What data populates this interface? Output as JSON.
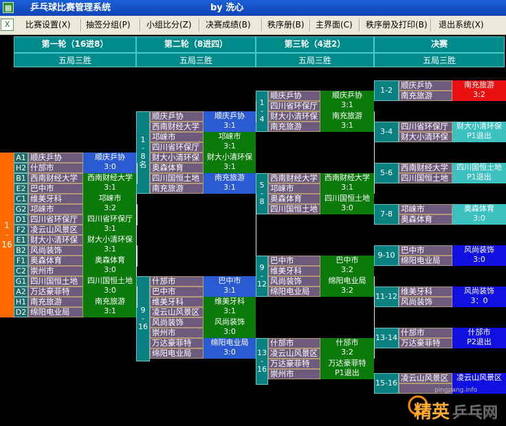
{
  "window": {
    "title": "乒乓球比赛管理系统",
    "author": "by 洗心"
  },
  "menu": [
    "比赛设置(X)",
    "抽签分组(P)",
    "小组比分(Z)",
    "决赛成绩(B)",
    "秩序册(B)",
    "主界面(C)",
    "秩序册及打印(B)",
    "退出系统(X)"
  ],
  "rounds": [
    {
      "title": "第一轮（16进8）",
      "format": "五局三胜"
    },
    {
      "title": "第二轮（8进四）",
      "format": "五局三胜"
    },
    {
      "title": "第三轮（4进2）",
      "format": "五局三胜"
    },
    {
      "title": "决赛",
      "format": "五局三胜"
    }
  ],
  "labels": {
    "big": "1\n-\n16",
    "r2a": "1\n-\n8\n名",
    "r2b": "9\n-\n16",
    "r3a": "1\n-\n4",
    "r3b": "5\n-\n8",
    "r3c": "9\n-\n12",
    "r3d": "13\n-\n16"
  },
  "round1": [
    {
      "s1": "A1",
      "t1": "顺庆乒协",
      "s2": "H2",
      "t2": "什邡市",
      "winner": "顺庆乒协",
      "score": "3:0",
      "color": "#2b5bd3"
    },
    {
      "s1": "B1",
      "t1": "西南财经大学",
      "s2": "E2",
      "t2": "巴中市",
      "winner": "西南财经大学",
      "score": "3:1",
      "color": "#0b7a0b"
    },
    {
      "s1": "C1",
      "t1": "维美牙科",
      "s2": "G2",
      "t2": "邛崃市",
      "winner": "邛崃市",
      "score": "3:2",
      "color": "#0b7a0b"
    },
    {
      "s1": "D1",
      "t1": "四川省环保厅",
      "s2": "F2",
      "t2": "凌云山风景区",
      "winner": "四川省环保厅",
      "score": "3:1",
      "color": "#0b7a0b"
    },
    {
      "s1": "E1",
      "t1": "财大小清环保",
      "s2": "B2",
      "t2": "风尚装饰",
      "winner": "财大小清环保",
      "score": "3:1",
      "color": "#0b7a0b"
    },
    {
      "s1": "F1",
      "t1": "奥森体育",
      "s2": "C2",
      "t2": "崇州市",
      "winner": "奥森体育",
      "score": "3:0",
      "color": "#0b7a0b"
    },
    {
      "s1": "G1",
      "t1": "四川国恒土地",
      "s2": "A2",
      "t2": "万达豪菲特",
      "winner": "四川国恒土地",
      "score": "3:0",
      "color": "#0b7a0b"
    },
    {
      "s1": "H1",
      "t1": "南充旅游",
      "s2": "D2",
      "t2": "绵阳电业局",
      "winner": "南充旅游",
      "score": "3:1",
      "color": "#0b7a0b"
    }
  ],
  "round2": [
    {
      "t1": "顺庆乒协",
      "t2": "西南财经大学",
      "winner": "顺庆乒协",
      "score": "3:1",
      "color": "#2b5bd3"
    },
    {
      "t1": "邛崃市",
      "t2": "四川省环保厅",
      "winner": "邛崃市",
      "score": "3:1",
      "color": "#0b7a0b"
    },
    {
      "t1": "财大小清环保",
      "t2": "奥森体育",
      "winner": "财大小清环保",
      "score": "3:1",
      "color": "#0b7a0b"
    },
    {
      "t1": "四川国恒土地",
      "t2": "南充旅游",
      "winner": "南充旅游",
      "score": "3:1",
      "color": "#2b5bd3"
    },
    {
      "t1": "什邡市",
      "t2": "巴中市",
      "winner": "巴中市",
      "score": "3:1",
      "color": "#2b5bd3"
    },
    {
      "t1": "维美牙科",
      "t2": "凌云山风景区",
      "winner": "维美牙科",
      "score": "3:1",
      "color": "#0b7a0b"
    },
    {
      "t1": "风尚装饰",
      "t2": "崇州市",
      "winner": "风尚装饰",
      "score": "3:0",
      "color": "#0b7a0b"
    },
    {
      "t1": "万达豪菲特",
      "t2": "绵阳电业局",
      "winner": "绵阳电业局",
      "score": "3:0",
      "color": "#2b5bd3"
    }
  ],
  "round3": [
    {
      "t1": "顺庆乒协",
      "t2": "四川省环保厅",
      "winner": "顺庆乒协",
      "score": "3:1",
      "color": "#0b7a0b"
    },
    {
      "t1": "财大小清环保",
      "t2": "南充旅游",
      "winner": "南充旅游",
      "score": "3:1",
      "color": "#0b7a0b"
    },
    {
      "t1": "西南财经大学",
      "t2": "邛崃市",
      "winner": "西南财经大学",
      "score": "3:1",
      "color": "#0b7a0b"
    },
    {
      "t1": "奥森体育",
      "t2": "四川国恒土地",
      "winner": "四川国恒土地",
      "score": "3:0",
      "color": "#0b7a0b"
    },
    {
      "t1": "巴中市",
      "t2": "维美牙科",
      "winner": "巴中市",
      "score": "3:2",
      "color": "#0b7a0b"
    },
    {
      "t1": "风尚装饰",
      "t2": "绵阳电业局",
      "winner": "绵阳电业局",
      "score": "3:2",
      "color": "#0b7a0b"
    },
    {
      "t1": "什邡市",
      "t2": "凌云山风景区",
      "winner": "什邡市",
      "score": "3:2",
      "color": "#0b7a0b"
    },
    {
      "t1": "万达豪菲特",
      "t2": "崇州市",
      "winner": "万达豪菲特",
      "score": "P1退出",
      "color": "#0b7a0b"
    }
  ],
  "finals": [
    {
      "place": "1-2",
      "t1": "顺庆乒协",
      "t2": "南充旅游",
      "winner": "南充旅游",
      "score": "3:2",
      "color": "#e81010"
    },
    {
      "place": "3-4",
      "t1": "四川省环保厅",
      "t2": "财大小清环保",
      "winner": "财大小清环保",
      "score": "P1退出",
      "color": "#3cc0c0"
    },
    {
      "place": "5-6",
      "t1": "西南财经大学",
      "t2": "四川国恒土地",
      "winner": "四川国恒土地",
      "score": "P1退出",
      "color": "#3cc0c0"
    },
    {
      "place": "7-8",
      "t1": "邛崃市",
      "t2": "奥森体育",
      "winner": "奥森体育",
      "score": "3:0",
      "color": "#3cc0c0"
    },
    {
      "place": "9-10",
      "t1": "巴中市",
      "t2": "绵阳电业局",
      "winner": "风尚装饰",
      "score": "3:0",
      "color": "#1010e0"
    },
    {
      "place": "11-12",
      "t1": "维美牙科",
      "t2": "风尚装饰",
      "winner": "风尚装饰",
      "score": "3：0",
      "color": "#1010e0"
    },
    {
      "place": "13-14",
      "t1": "什邡市",
      "t2": "万达豪菲特",
      "winner": "什邡市",
      "score": "P2退出",
      "color": "#1010e0"
    },
    {
      "place": "15-16",
      "t1": "凌云山风景区",
      "t2": "",
      "winner": "凌云山风景区",
      "score": "",
      "color": "#1010e0"
    }
  ],
  "watermark": {
    "text": "乒乓网",
    "prefix": "精英",
    "url": "pingpang.info"
  }
}
